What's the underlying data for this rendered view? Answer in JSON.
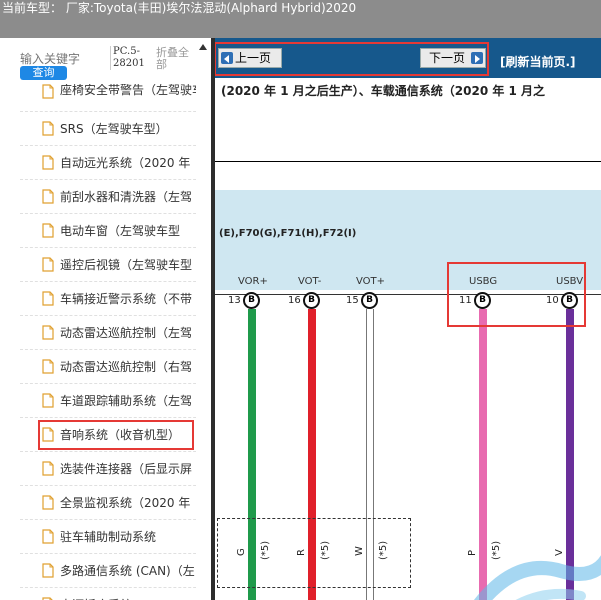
{
  "header": {
    "title": "当前车型： 厂家:Toyota(丰田)埃尔法混动(Alphard Hybrid)2020"
  },
  "sidebar": {
    "search_placeholder": "输入关键字",
    "search_button": "查询",
    "pc_code": "PC.5-28201",
    "collapse_label": "折叠全部",
    "items": [
      {
        "label": "座椅安全带警告（左驾驶车型）"
      },
      {
        "label": "SRS（左驾驶车型）"
      },
      {
        "label": "自动远光系统（2020 年"
      },
      {
        "label": "前刮水器和清洗器（左驾"
      },
      {
        "label": "电动车窗（左驾驶车型"
      },
      {
        "label": "遥控后视镜（左驾驶车型"
      },
      {
        "label": "车辆接近警示系统（不带"
      },
      {
        "label": "动态雷达巡航控制（左驾"
      },
      {
        "label": "动态雷达巡航控制（右驾"
      },
      {
        "label": "车道跟踪辅助系统（左驾"
      },
      {
        "label": "音响系统（收音机型）"
      },
      {
        "label": "选装件连接器（后显示屏"
      },
      {
        "label": "全景监视系统（2020 年"
      },
      {
        "label": "驻车辅助制动系统"
      },
      {
        "label": "多路通信系统 (CAN)（左"
      },
      {
        "label": "电源插座系统"
      }
    ]
  },
  "nav": {
    "prev": "上一页",
    "next": "下一页",
    "refresh": "[刷新当前页.]"
  },
  "diagram": {
    "header_text": "(2020 年 1 月之后生产）、车载通信系统（2020 年 1 月之",
    "connector_label": "(E),F70(G),F71(H),F72(I)",
    "pins": [
      {
        "signal": "VOR+",
        "num": "13",
        "letter": "B",
        "wire_color": "#1f9a4b",
        "color_code": "G",
        "note": "(*5)"
      },
      {
        "signal": "VOT-",
        "num": "16",
        "letter": "B",
        "wire_color": "#e0202a",
        "color_code": "R",
        "note": "(*5)"
      },
      {
        "signal": "VOT+",
        "num": "15",
        "letter": "B",
        "wire_color": "#ffffff",
        "color_code": "W",
        "note": "(*5)"
      },
      {
        "signal": "USBG",
        "num": "11",
        "letter": "B",
        "wire_color": "#e86bb0",
        "color_code": "P",
        "note": "(*5)"
      },
      {
        "signal": "USBV",
        "num": "10",
        "letter": "B",
        "wire_color": "#6a2f9a",
        "color_code": "V",
        "note": ""
      }
    ]
  },
  "colors": {
    "topbar": "#8c8c8c",
    "navbar": "#16588c",
    "highlight": "#e53935",
    "connector_band": "#cfe7f1"
  }
}
